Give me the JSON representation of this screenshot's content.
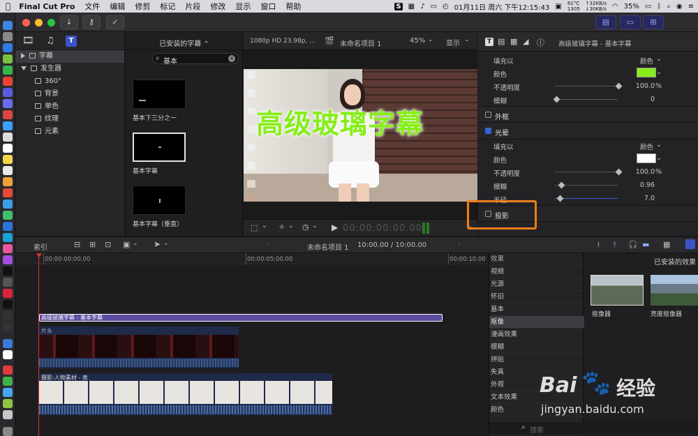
{
  "menubar": {
    "app": "Final Cut Pro",
    "items": [
      "文件",
      "编辑",
      "修剪",
      "标记",
      "片段",
      "修改",
      "显示",
      "窗口",
      "帮助"
    ],
    "datetime": "01月11日 周六 下午12:15:43",
    "temp": "61°C",
    "rpm": "1305",
    "net_up": "↑32KB/s",
    "net_down": "↓30KB/s",
    "battery": "35%"
  },
  "library": {
    "items": [
      {
        "label": "字幕",
        "level": 0,
        "expanded": false,
        "selected": true
      },
      {
        "label": "发生器",
        "level": 0,
        "expanded": true,
        "selected": false
      },
      {
        "label": "360°",
        "level": 1
      },
      {
        "label": "背景",
        "level": 1
      },
      {
        "label": "单色",
        "level": 1
      },
      {
        "label": "纹理",
        "level": 1
      },
      {
        "label": "元素",
        "level": 1
      }
    ]
  },
  "browser": {
    "title": "已安装的字幕 ⌃",
    "search_value": "基本",
    "thumbs": [
      {
        "label": "基本下三分之一",
        "selected": false
      },
      {
        "label": "基本字幕",
        "selected": true
      },
      {
        "label": "基本字幕（垂直）",
        "selected": false
      }
    ]
  },
  "viewer": {
    "format": "1080p HD 23.98p, ...",
    "project": "未命名项目 1",
    "zoom": "45%",
    "display": "显示",
    "overlay_text": "高级玻璃字幕",
    "timecode": "00:00:00:00.00"
  },
  "inspector": {
    "title": "高级玻璃字幕 - 基本字幕",
    "fill_label": "填充以",
    "fill_value": "颜色",
    "color_label": "颜色",
    "opacity_label": "不透明度",
    "opacity_value": "100.0",
    "opacity_unit": "%",
    "blur_label": "模糊",
    "blur_value": "0",
    "outline_label": "外框",
    "glow_label": "光晕",
    "glow_fill_label": "填充以",
    "glow_fill_value": "颜色",
    "glow_color_label": "颜色",
    "glow_opacity_label": "不透明度",
    "glow_opacity_value": "100.0",
    "glow_opacity_unit": "%",
    "glow_blur_label": "模糊",
    "glow_blur_value": "0.96",
    "glow_radius_label": "半径",
    "glow_radius_value": "7.0",
    "shadow_label": "投影",
    "colors": {
      "face": "#86ee1a",
      "glow": "#ffffff"
    }
  },
  "timeline": {
    "index_label": "索引",
    "project": "未命名项目 1",
    "duration": "10:00.00 / 10:00.00",
    "ticks": [
      "00:00:00:00.00",
      "00:00:05:00.00",
      "00:00:10.00"
    ],
    "title_clip": "高级玻璃字幕 - 基本字幕",
    "clip1": "片头",
    "clip2": "摄影-人物素材 - 表"
  },
  "effects": {
    "header": "效果",
    "installed": "已安装的效果",
    "items": [
      "视频",
      "光源",
      "怀旧",
      "基本",
      "抠像",
      "漫画效果",
      "模糊",
      "拼贴",
      "失真",
      "外观",
      "文本效果",
      "颜色"
    ],
    "selected": "抠像",
    "tiles": [
      "抠像器",
      "亮度抠像器"
    ],
    "search_placeholder": "搜索"
  },
  "watermark": {
    "brand": "Bai",
    "brand2": "经验",
    "url": "jingyan.baidu.com"
  }
}
